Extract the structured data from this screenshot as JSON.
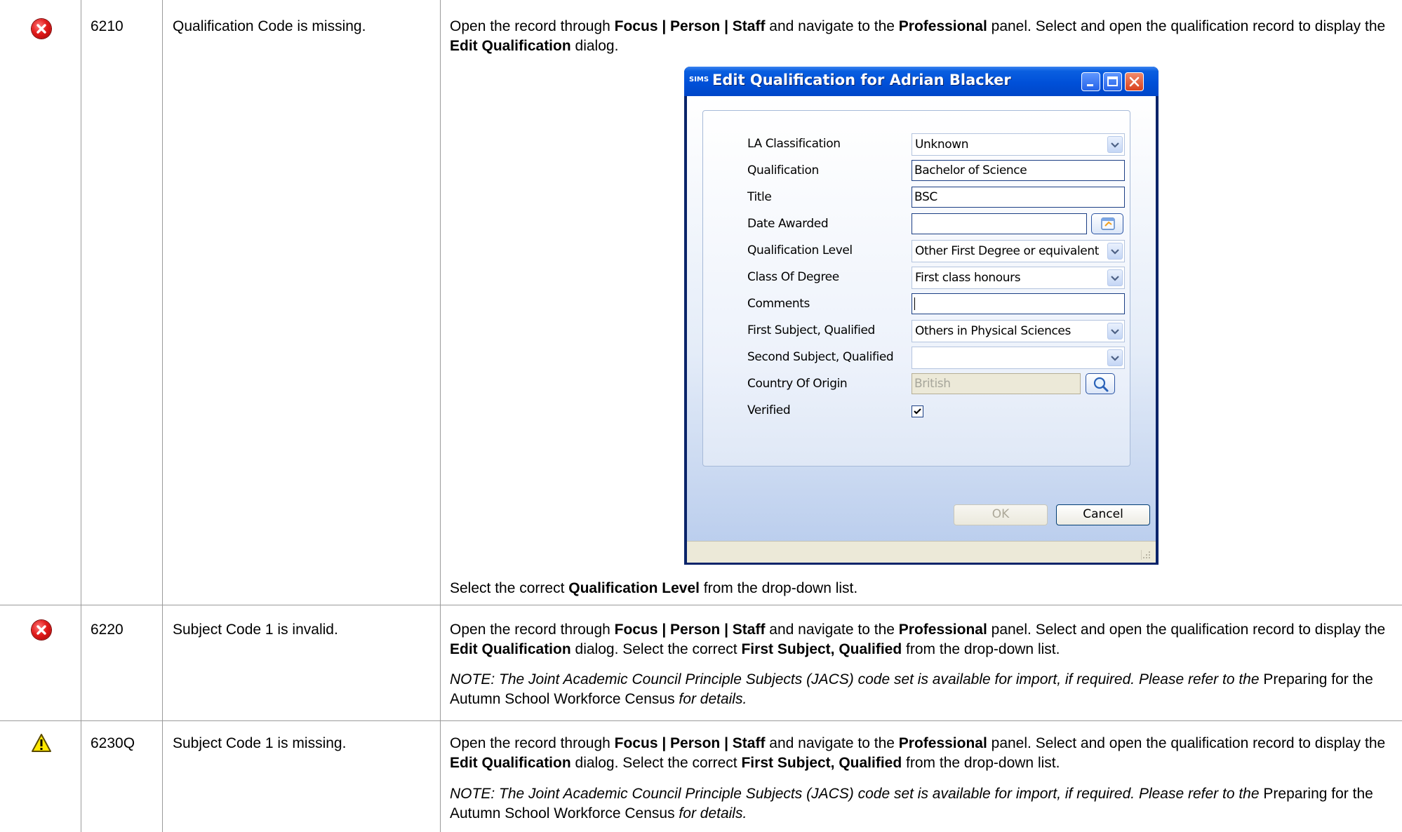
{
  "rows": [
    {
      "status_icon": "error-icon",
      "code": "6210",
      "message": "Qualification Code is missing.",
      "action_parts": [
        {
          "text": "Open the record through ",
          "bold": false
        },
        {
          "text": "Focus | Person | Staff",
          "bold": true
        },
        {
          "text": " and navigate to the ",
          "bold": false
        },
        {
          "text": "Professional",
          "bold": true
        },
        {
          "text": " panel. Select and open the qualification record to display the ",
          "bold": false
        },
        {
          "text": "Edit Qualification",
          "bold": true
        },
        {
          "text": " dialog.",
          "bold": false
        }
      ],
      "after_dialog_parts": [
        {
          "text": "Select the correct ",
          "bold": false
        },
        {
          "text": "Qualification Level",
          "bold": true
        },
        {
          "text": " from the drop-down list.",
          "bold": false
        }
      ]
    },
    {
      "status_icon": "error-icon",
      "code": "6220",
      "message": "Subject Code 1 is invalid.",
      "action_parts": [
        {
          "text": "Open the record through ",
          "bold": false
        },
        {
          "text": "Focus | Person | Staff",
          "bold": true
        },
        {
          "text": " and navigate to the ",
          "bold": false
        },
        {
          "text": "Professional",
          "bold": true
        },
        {
          "text": " panel. Select and open the qualification record to display the ",
          "bold": false
        },
        {
          "text": "Edit Qualification",
          "bold": true
        },
        {
          "text": " dialog. Select the correct ",
          "bold": false
        },
        {
          "text": "First Subject, Qualified",
          "bold": true
        },
        {
          "text": " from the drop-down list.",
          "bold": false
        }
      ],
      "note_italic": "NOTE: The Joint Academic Council Principle Subjects (JACS) code set is available for import, if required. Please refer to the ",
      "note_plain": "Preparing for the Autumn School Workforce Census",
      "note_tail": " for details."
    },
    {
      "status_icon": "warning-icon",
      "code": "6230Q",
      "message": "Subject Code 1 is missing.",
      "action_parts": [
        {
          "text": "Open the record through ",
          "bold": false
        },
        {
          "text": "Focus | Person | Staff",
          "bold": true
        },
        {
          "text": " and navigate to the ",
          "bold": false
        },
        {
          "text": "Professional",
          "bold": true
        },
        {
          "text": " panel. Select and open the qualification record to display the ",
          "bold": false
        },
        {
          "text": "Edit Qualification",
          "bold": true
        },
        {
          "text": " dialog. Select the correct ",
          "bold": false
        },
        {
          "text": "First Subject, Qualified",
          "bold": true
        },
        {
          "text": " from the drop-down list.",
          "bold": false
        }
      ],
      "note_italic": "NOTE: The Joint Academic Council Principle Subjects (JACS) code set is available for import, if required. Please refer to the ",
      "note_plain": "Preparing for the Autumn School Workforce Census",
      "note_tail": " for details."
    }
  ],
  "dialog": {
    "app_logo": "SIMS",
    "title": "Edit Qualification for Adrian Blacker",
    "fields": {
      "la_classification": {
        "label": "LA Classification",
        "value": "Unknown"
      },
      "qualification": {
        "label": "Qualification",
        "value": "Bachelor of Science"
      },
      "title": {
        "label": "Title",
        "value": "BSC"
      },
      "date_awarded": {
        "label": "Date Awarded",
        "value": ""
      },
      "qualification_level": {
        "label": "Qualification Level",
        "value": "Other First Degree or equivalent"
      },
      "class_of_degree": {
        "label": "Class Of Degree",
        "value": "First class honours"
      },
      "comments": {
        "label": "Comments",
        "value": ""
      },
      "first_subject": {
        "label": "First Subject, Qualified",
        "value": "Others in Physical Sciences"
      },
      "second_subject": {
        "label": "Second Subject, Qualified",
        "value": ""
      },
      "country_of_origin": {
        "label": "Country Of Origin",
        "value": "British"
      },
      "verified": {
        "label": "Verified",
        "checked": true
      }
    },
    "ok_label": "OK",
    "cancel_label": "Cancel"
  }
}
